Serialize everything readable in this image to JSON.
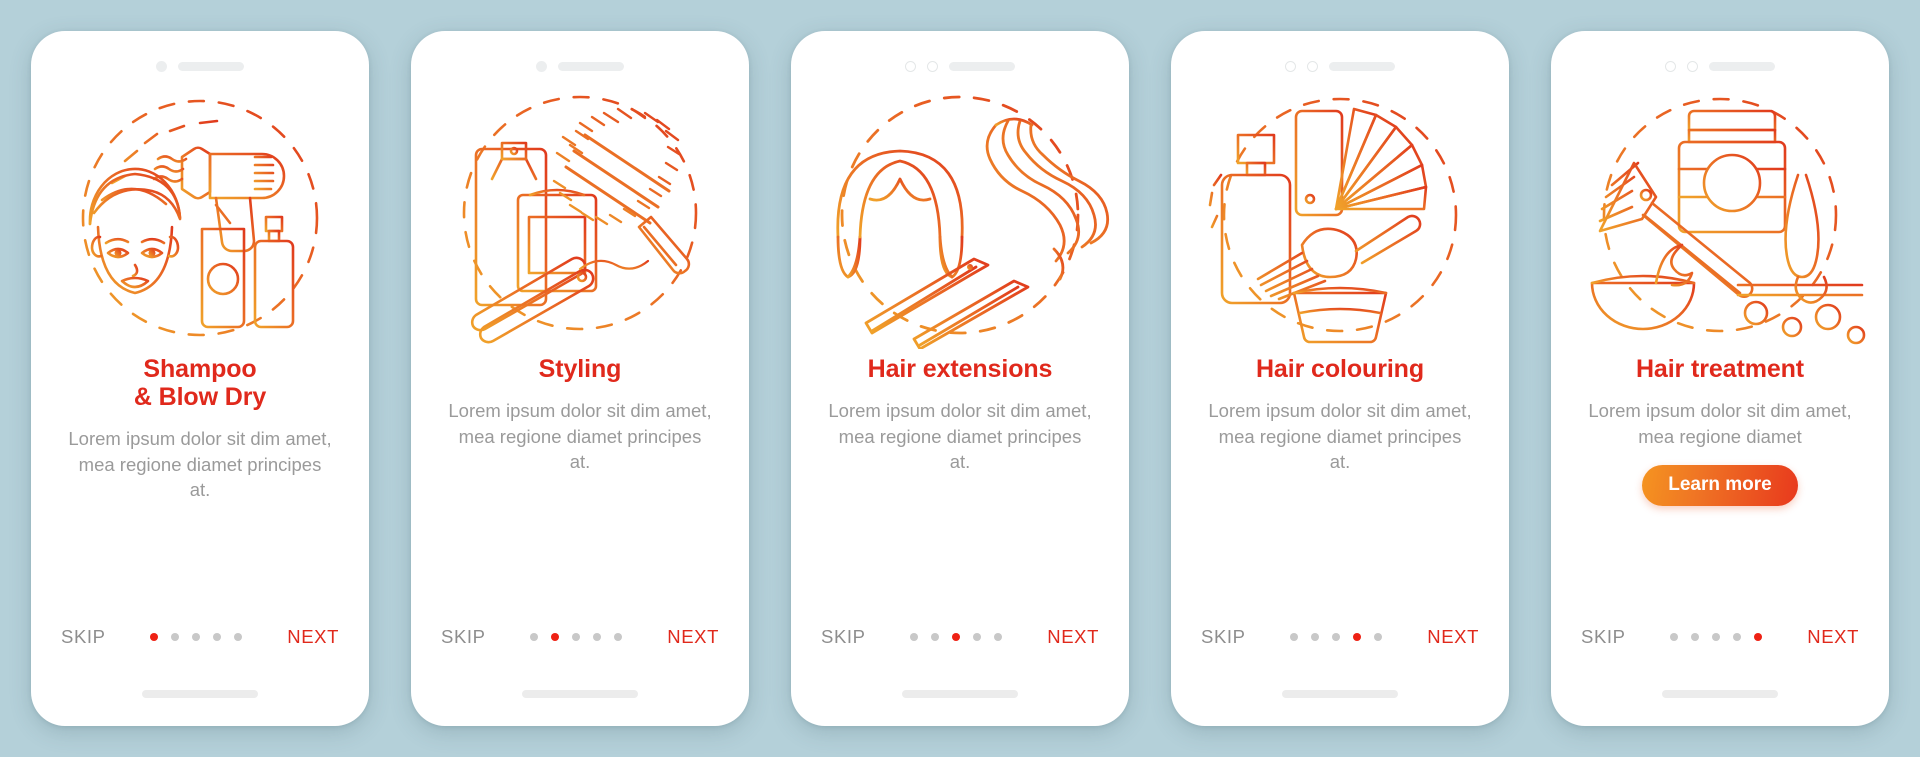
{
  "background_color": "#b4d0d9",
  "accent_colors": {
    "title_red": "#e0291c",
    "dot_active": "#ee2114",
    "next_red": "#e0291c",
    "skip_gray": "#8e8e8e",
    "desc_gray": "#9a9a9a",
    "gradient_start": "#f59420",
    "gradient_end": "#e8391d"
  },
  "common": {
    "skip_label": "SKIP",
    "next_label": "NEXT",
    "description": "Lorem ipsum dolor sit dim amet, mea regione diamet principes at.",
    "dot_count": 5
  },
  "screens": [
    {
      "id": "shampoo-blow-dry",
      "title": "Shampoo\n& Blow Dry",
      "description": "Lorem ipsum dolor sit dim amet, mea regione diamet principes at.",
      "skip_label": "SKIP",
      "next_label": "NEXT",
      "active_dot": 1,
      "notch_style": "solid-dot",
      "illustration": "hair-dryer-woman-towel-illustration",
      "cta": null
    },
    {
      "id": "styling",
      "title": "Styling",
      "description": "Lorem ipsum dolor sit dim amet, mea regione diamet principes at.",
      "skip_label": "SKIP",
      "next_label": "NEXT",
      "active_dot": 2,
      "notch_style": "solid-dot",
      "illustration": "spray-jar-brush-flat-iron-illustration",
      "cta": null
    },
    {
      "id": "hair-extensions",
      "title": "Hair extensions",
      "description": "Lorem ipsum dolor sit dim amet, mea regione diamet principes at.",
      "skip_label": "SKIP",
      "next_label": "NEXT",
      "active_dot": 3,
      "notch_style": "two-rings",
      "illustration": "wig-hair-strand-clips-illustration",
      "cta": null
    },
    {
      "id": "hair-colouring",
      "title": "Hair colouring",
      "description": "Lorem ipsum dolor sit dim amet, mea regione diamet principes at.",
      "skip_label": "SKIP",
      "next_label": "NEXT",
      "active_dot": 4,
      "notch_style": "two-rings",
      "illustration": "bottle-swatch-fan-tint-brush-bowl-illustration",
      "cta": null
    },
    {
      "id": "hair-treatment",
      "title": "Hair treatment",
      "description": "Lorem ipsum dolor sit dim amet, mea regione diamet",
      "skip_label": "SKIP",
      "next_label": "NEXT",
      "active_dot": 5,
      "notch_style": "two-rings",
      "illustration": "tint-brush-jar-bowl-follicle-illustration",
      "cta": "Learn more"
    }
  ]
}
